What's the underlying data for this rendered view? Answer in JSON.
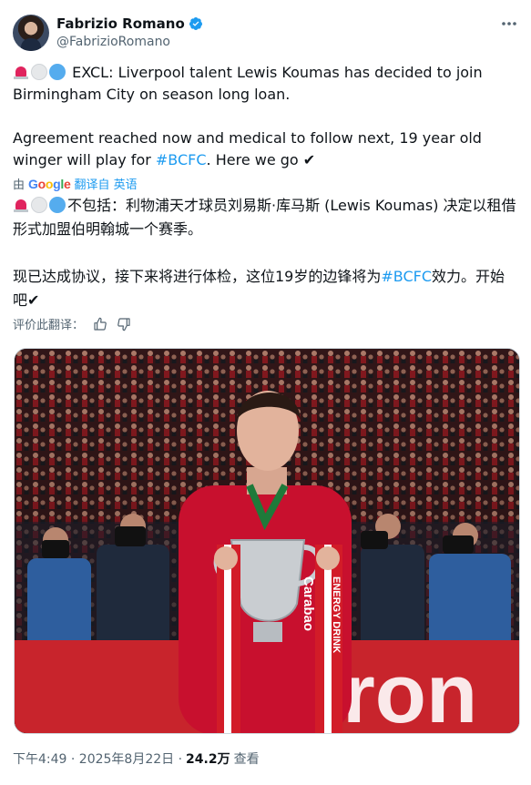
{
  "author": {
    "display_name": "Fabrizio Romano",
    "handle": "@FabrizioRomano",
    "verified": true,
    "more_icon": "more-horizontal-icon"
  },
  "tweet": {
    "line1": "EXCL: Liverpool talent Lewis Koumas has decided to join Birmingham City on season long loan.",
    "line2_pre": "Agreement reached now and medical to follow next, 19 year old winger will play for ",
    "hashtag": "#BCFC",
    "line2_post": ". Here we go ",
    "check": "✔"
  },
  "translation": {
    "by": "由",
    "google": [
      "G",
      "o",
      "o",
      "g",
      "l",
      "e"
    ],
    "link": "翻译自 英语",
    "line1": "不包括：利物浦天才球员刘易斯·库马斯 (Lewis Koumas) 决定以租借形式加盟伯明翰城一个赛季。",
    "line2_pre": "现已达成协议，接下来将进行体检，这位19岁的边锋将为",
    "hashtag": "#BCFC",
    "line2_post": "效力。开始吧",
    "check": "✔"
  },
  "rate": {
    "label": "评价此翻译："
  },
  "meta": {
    "time": "下午4:49 · 2025年8月22日 · ",
    "views": "24.2万",
    "views_label": "查看"
  },
  "media": {
    "alt": "Lewis Koumas holding Carabao Cup trophy",
    "ribbon_text_1": "Carabao",
    "ribbon_text_2": "ENERGY DRINK",
    "board_text": "ron"
  }
}
